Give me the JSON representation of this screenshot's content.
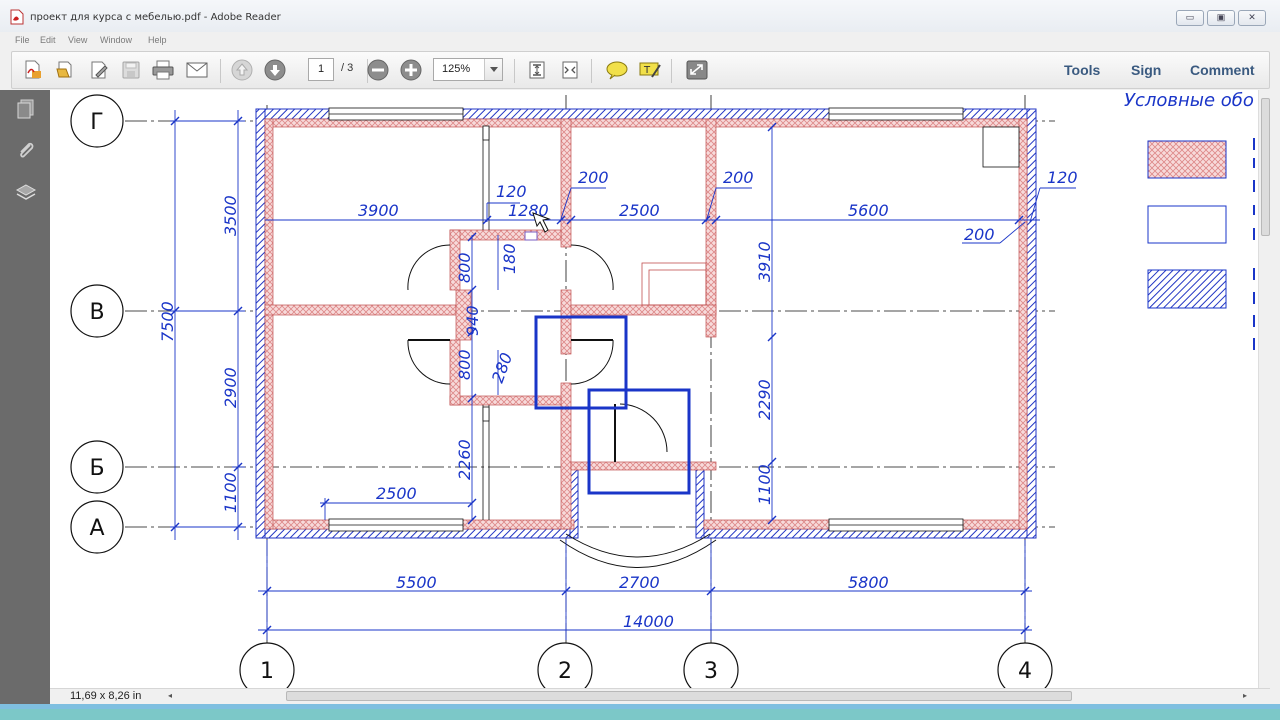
{
  "window": {
    "title": "проект для курса с мебелью.pdf - Adobe Reader",
    "controls": {
      "minimize": "▭",
      "restore": "▣",
      "close": "✕"
    }
  },
  "menu": [
    "File",
    "Edit",
    "View",
    "Window",
    "Help"
  ],
  "toolbar": {
    "page_current": "1",
    "page_total": "/ 3",
    "zoom": "125%",
    "tools_label": "Tools",
    "sign_label": "Sign",
    "comment_label": "Comment"
  },
  "status": {
    "page_size": "11,69 x 8,26 in"
  },
  "drawing": {
    "axis_rows": [
      "Г",
      "В",
      "Б",
      "А"
    ],
    "axis_cols": [
      "1",
      "2",
      "3",
      "4"
    ],
    "dims_top": [
      "3900",
      "1280",
      "2500",
      "5600"
    ],
    "dims_small": [
      "120",
      "200",
      "200",
      "120",
      "200"
    ],
    "dims_left_outer": "7500",
    "dims_left_inner": [
      "3500",
      "2900",
      "1100"
    ],
    "dims_bottom": [
      "5500",
      "2700",
      "5800"
    ],
    "dims_total": "14000",
    "dims_inner_vertical": [
      "800",
      "180",
      "940",
      "800",
      "280",
      "2260"
    ],
    "dims_right_vertical": [
      "3910",
      "2290",
      "1100"
    ],
    "dim_inner_room": "2500",
    "legend_title": "Условные обо"
  },
  "colors": {
    "accent_blue": "#1a35c8",
    "wall_red": "#c0504d",
    "ui_link": "#3a5a80"
  }
}
